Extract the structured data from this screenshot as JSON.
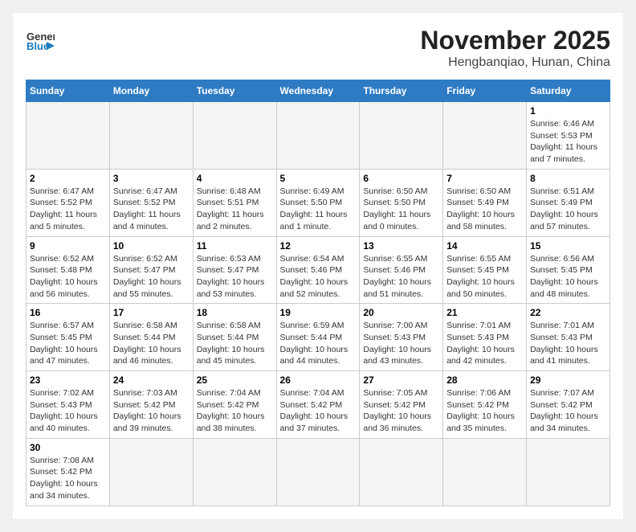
{
  "header": {
    "logo_general": "General",
    "logo_blue": "Blue",
    "title": "November 2025",
    "subtitle": "Hengbanqiao, Hunan, China"
  },
  "weekdays": [
    "Sunday",
    "Monday",
    "Tuesday",
    "Wednesday",
    "Thursday",
    "Friday",
    "Saturday"
  ],
  "weeks": [
    [
      {
        "num": "",
        "sunrise": "",
        "sunset": "",
        "daylight": ""
      },
      {
        "num": "",
        "sunrise": "",
        "sunset": "",
        "daylight": ""
      },
      {
        "num": "",
        "sunrise": "",
        "sunset": "",
        "daylight": ""
      },
      {
        "num": "",
        "sunrise": "",
        "sunset": "",
        "daylight": ""
      },
      {
        "num": "",
        "sunrise": "",
        "sunset": "",
        "daylight": ""
      },
      {
        "num": "",
        "sunrise": "",
        "sunset": "",
        "daylight": ""
      },
      {
        "num": "1",
        "sunrise": "Sunrise: 6:46 AM",
        "sunset": "Sunset: 5:53 PM",
        "daylight": "Daylight: 11 hours and 7 minutes."
      }
    ],
    [
      {
        "num": "2",
        "sunrise": "Sunrise: 6:47 AM",
        "sunset": "Sunset: 5:52 PM",
        "daylight": "Daylight: 11 hours and 5 minutes."
      },
      {
        "num": "3",
        "sunrise": "Sunrise: 6:47 AM",
        "sunset": "Sunset: 5:52 PM",
        "daylight": "Daylight: 11 hours and 4 minutes."
      },
      {
        "num": "4",
        "sunrise": "Sunrise: 6:48 AM",
        "sunset": "Sunset: 5:51 PM",
        "daylight": "Daylight: 11 hours and 2 minutes."
      },
      {
        "num": "5",
        "sunrise": "Sunrise: 6:49 AM",
        "sunset": "Sunset: 5:50 PM",
        "daylight": "Daylight: 11 hours and 1 minute."
      },
      {
        "num": "6",
        "sunrise": "Sunrise: 6:50 AM",
        "sunset": "Sunset: 5:50 PM",
        "daylight": "Daylight: 11 hours and 0 minutes."
      },
      {
        "num": "7",
        "sunrise": "Sunrise: 6:50 AM",
        "sunset": "Sunset: 5:49 PM",
        "daylight": "Daylight: 10 hours and 58 minutes."
      },
      {
        "num": "8",
        "sunrise": "Sunrise: 6:51 AM",
        "sunset": "Sunset: 5:49 PM",
        "daylight": "Daylight: 10 hours and 57 minutes."
      }
    ],
    [
      {
        "num": "9",
        "sunrise": "Sunrise: 6:52 AM",
        "sunset": "Sunset: 5:48 PM",
        "daylight": "Daylight: 10 hours and 56 minutes."
      },
      {
        "num": "10",
        "sunrise": "Sunrise: 6:52 AM",
        "sunset": "Sunset: 5:47 PM",
        "daylight": "Daylight: 10 hours and 55 minutes."
      },
      {
        "num": "11",
        "sunrise": "Sunrise: 6:53 AM",
        "sunset": "Sunset: 5:47 PM",
        "daylight": "Daylight: 10 hours and 53 minutes."
      },
      {
        "num": "12",
        "sunrise": "Sunrise: 6:54 AM",
        "sunset": "Sunset: 5:46 PM",
        "daylight": "Daylight: 10 hours and 52 minutes."
      },
      {
        "num": "13",
        "sunrise": "Sunrise: 6:55 AM",
        "sunset": "Sunset: 5:46 PM",
        "daylight": "Daylight: 10 hours and 51 minutes."
      },
      {
        "num": "14",
        "sunrise": "Sunrise: 6:55 AM",
        "sunset": "Sunset: 5:45 PM",
        "daylight": "Daylight: 10 hours and 50 minutes."
      },
      {
        "num": "15",
        "sunrise": "Sunrise: 6:56 AM",
        "sunset": "Sunset: 5:45 PM",
        "daylight": "Daylight: 10 hours and 48 minutes."
      }
    ],
    [
      {
        "num": "16",
        "sunrise": "Sunrise: 6:57 AM",
        "sunset": "Sunset: 5:45 PM",
        "daylight": "Daylight: 10 hours and 47 minutes."
      },
      {
        "num": "17",
        "sunrise": "Sunrise: 6:58 AM",
        "sunset": "Sunset: 5:44 PM",
        "daylight": "Daylight: 10 hours and 46 minutes."
      },
      {
        "num": "18",
        "sunrise": "Sunrise: 6:58 AM",
        "sunset": "Sunset: 5:44 PM",
        "daylight": "Daylight: 10 hours and 45 minutes."
      },
      {
        "num": "19",
        "sunrise": "Sunrise: 6:59 AM",
        "sunset": "Sunset: 5:44 PM",
        "daylight": "Daylight: 10 hours and 44 minutes."
      },
      {
        "num": "20",
        "sunrise": "Sunrise: 7:00 AM",
        "sunset": "Sunset: 5:43 PM",
        "daylight": "Daylight: 10 hours and 43 minutes."
      },
      {
        "num": "21",
        "sunrise": "Sunrise: 7:01 AM",
        "sunset": "Sunset: 5:43 PM",
        "daylight": "Daylight: 10 hours and 42 minutes."
      },
      {
        "num": "22",
        "sunrise": "Sunrise: 7:01 AM",
        "sunset": "Sunset: 5:43 PM",
        "daylight": "Daylight: 10 hours and 41 minutes."
      }
    ],
    [
      {
        "num": "23",
        "sunrise": "Sunrise: 7:02 AM",
        "sunset": "Sunset: 5:43 PM",
        "daylight": "Daylight: 10 hours and 40 minutes."
      },
      {
        "num": "24",
        "sunrise": "Sunrise: 7:03 AM",
        "sunset": "Sunset: 5:42 PM",
        "daylight": "Daylight: 10 hours and 39 minutes."
      },
      {
        "num": "25",
        "sunrise": "Sunrise: 7:04 AM",
        "sunset": "Sunset: 5:42 PM",
        "daylight": "Daylight: 10 hours and 38 minutes."
      },
      {
        "num": "26",
        "sunrise": "Sunrise: 7:04 AM",
        "sunset": "Sunset: 5:42 PM",
        "daylight": "Daylight: 10 hours and 37 minutes."
      },
      {
        "num": "27",
        "sunrise": "Sunrise: 7:05 AM",
        "sunset": "Sunset: 5:42 PM",
        "daylight": "Daylight: 10 hours and 36 minutes."
      },
      {
        "num": "28",
        "sunrise": "Sunrise: 7:06 AM",
        "sunset": "Sunset: 5:42 PM",
        "daylight": "Daylight: 10 hours and 35 minutes."
      },
      {
        "num": "29",
        "sunrise": "Sunrise: 7:07 AM",
        "sunset": "Sunset: 5:42 PM",
        "daylight": "Daylight: 10 hours and 34 minutes."
      }
    ],
    [
      {
        "num": "30",
        "sunrise": "Sunrise: 7:08 AM",
        "sunset": "Sunset: 5:42 PM",
        "daylight": "Daylight: 10 hours and 34 minutes."
      },
      {
        "num": "",
        "sunrise": "",
        "sunset": "",
        "daylight": ""
      },
      {
        "num": "",
        "sunrise": "",
        "sunset": "",
        "daylight": ""
      },
      {
        "num": "",
        "sunrise": "",
        "sunset": "",
        "daylight": ""
      },
      {
        "num": "",
        "sunrise": "",
        "sunset": "",
        "daylight": ""
      },
      {
        "num": "",
        "sunrise": "",
        "sunset": "",
        "daylight": ""
      },
      {
        "num": "",
        "sunrise": "",
        "sunset": "",
        "daylight": ""
      }
    ]
  ]
}
